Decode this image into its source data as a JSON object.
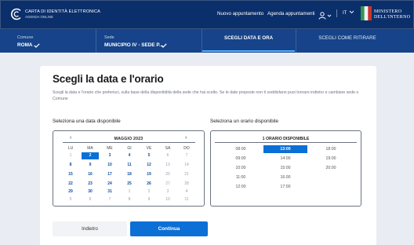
{
  "header": {
    "logo_title": "CARTA DI IDENTITÀ ELETTRONICA",
    "logo_subtitle": "AGENDA ONLINE",
    "nav_new": "Nuovo appuntamento",
    "nav_agenda": "Agenda appuntamenti",
    "lang": "IT",
    "ministry_line1": "MINISTERO",
    "ministry_line2": "DELL'INTERNO"
  },
  "steps": {
    "comune_label": "Comune",
    "comune_value": "ROMA",
    "sede_label": "Sede",
    "sede_value": "MUNICIPIO IV - SEDE P...",
    "active": "SCEGLI DATA E ORA",
    "next": "SCEGLI COME RITIRARE"
  },
  "card": {
    "title": "Scegli la data e l'orario",
    "description": "Scegli la data e l'orario che preferisci, sulla base della disponibilità della sede che hai scelto. Se le date proposte non ti soddisfano puoi tornare indietro e cambiare sede o Comune",
    "date_label": "Seleziona una data disponibile",
    "time_label": "Seleziona un orario disponibile"
  },
  "calendar": {
    "prev": "‹",
    "next": "›",
    "month": "MAGGIO 2023",
    "weekdays": [
      "LU",
      "MA",
      "ME",
      "GI",
      "VE",
      "SA",
      "DO"
    ],
    "weeks": [
      [
        {
          "d": "1",
          "s": "off"
        },
        {
          "d": "2",
          "s": "sel"
        },
        {
          "d": "3",
          "s": "avail"
        },
        {
          "d": "4",
          "s": "avail"
        },
        {
          "d": "5",
          "s": "avail"
        },
        {
          "d": "6",
          "s": "off"
        },
        {
          "d": "7",
          "s": "off"
        }
      ],
      [
        {
          "d": "8",
          "s": "avail"
        },
        {
          "d": "9",
          "s": "avail"
        },
        {
          "d": "10",
          "s": "avail"
        },
        {
          "d": "11",
          "s": "avail"
        },
        {
          "d": "12",
          "s": "avail"
        },
        {
          "d": "13",
          "s": "off"
        },
        {
          "d": "14",
          "s": "off"
        }
      ],
      [
        {
          "d": "15",
          "s": "avail"
        },
        {
          "d": "16",
          "s": "avail"
        },
        {
          "d": "17",
          "s": "avail"
        },
        {
          "d": "18",
          "s": "avail"
        },
        {
          "d": "19",
          "s": "avail"
        },
        {
          "d": "20",
          "s": "off"
        },
        {
          "d": "21",
          "s": "off"
        }
      ],
      [
        {
          "d": "22",
          "s": "avail"
        },
        {
          "d": "23",
          "s": "avail"
        },
        {
          "d": "24",
          "s": "avail"
        },
        {
          "d": "25",
          "s": "avail"
        },
        {
          "d": "26",
          "s": "avail"
        },
        {
          "d": "27",
          "s": "off"
        },
        {
          "d": "28",
          "s": "off"
        }
      ],
      [
        {
          "d": "29",
          "s": "avail"
        },
        {
          "d": "30",
          "s": "avail"
        },
        {
          "d": "31",
          "s": "avail"
        },
        {
          "d": "1",
          "s": "off"
        },
        {
          "d": "2",
          "s": "off"
        },
        {
          "d": "3",
          "s": "off"
        },
        {
          "d": "4",
          "s": "off"
        }
      ],
      [
        {
          "d": "5",
          "s": "off"
        },
        {
          "d": "6",
          "s": "off"
        },
        {
          "d": "7",
          "s": "off"
        },
        {
          "d": "8",
          "s": "off"
        },
        {
          "d": "9",
          "s": "off"
        },
        {
          "d": "10",
          "s": "off"
        },
        {
          "d": "11",
          "s": "off"
        }
      ]
    ]
  },
  "times": {
    "title": "1 ORARIO DISPONIBILE",
    "columns": [
      [
        "08:00",
        "09:00",
        "10:00",
        "11:00",
        "12:00"
      ],
      [
        "13:00",
        "14:00",
        "15:00",
        "16:00",
        "17:00"
      ],
      [
        "18:00",
        "19:00",
        "20:00"
      ]
    ],
    "selected": "13:00"
  },
  "buttons": {
    "back": "Indietro",
    "continue": "Continua"
  },
  "colors": {
    "header_bg": "#0b2f6b",
    "stepbar_bg": "#164389",
    "accent": "#0b6fd6",
    "link": "#0b4ea2"
  }
}
